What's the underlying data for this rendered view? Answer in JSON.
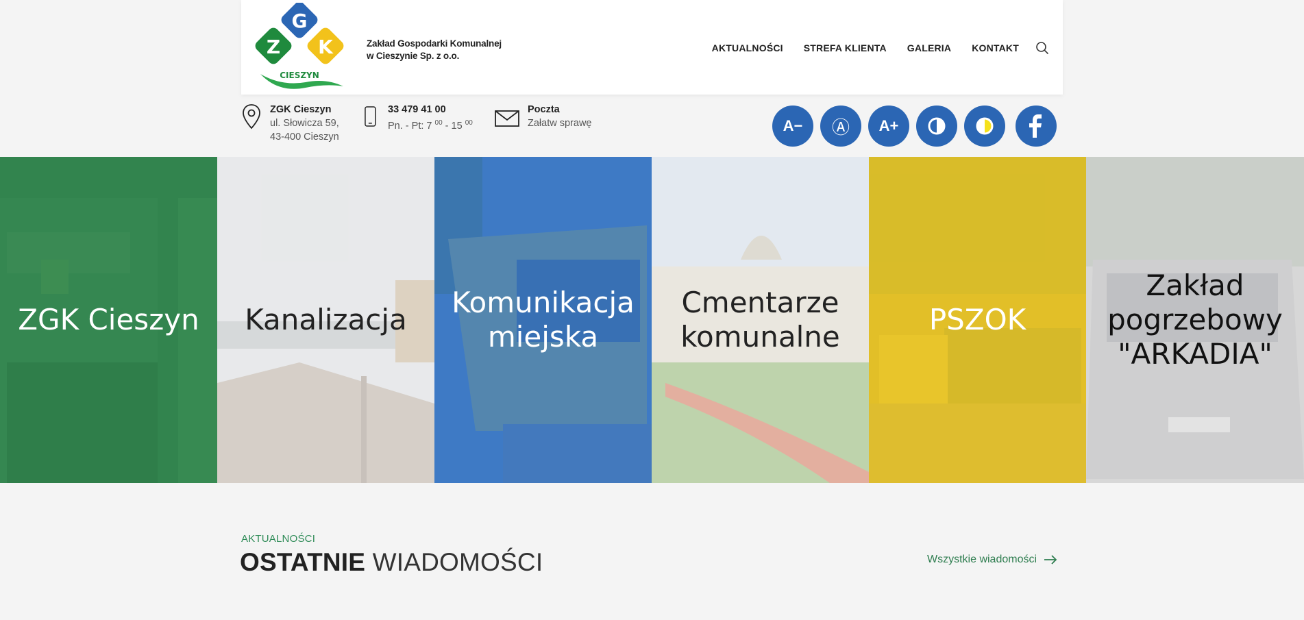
{
  "header": {
    "company_line1": "Zakład Gospodarki Komunalnej",
    "company_line2": "w Cieszynie Sp. z o.o.",
    "logo": {
      "letters": [
        "G",
        "Z",
        "K"
      ],
      "word": "CIESZYN"
    },
    "nav": [
      "AKTUALNOŚCI",
      "STREFA KLIENTA",
      "GALERIA",
      "KONTAKT"
    ],
    "search_icon": "search-icon"
  },
  "info": {
    "address": {
      "title": "ZGK Cieszyn",
      "line1": "ul. Słowicza 59,",
      "line2": "43-400 Cieszyn",
      "icon": "location-pin-icon"
    },
    "phone": {
      "title": "33 479 41 00",
      "hours_prefix": "Pn. - Pt: 7",
      "hours_open_sup": "00",
      "hours_mid": " - 15",
      "hours_close_sup": "00",
      "icon": "phone-icon"
    },
    "mail": {
      "title": "Poczta",
      "subtitle": "Załatw sprawę",
      "icon": "envelope-icon"
    }
  },
  "accessibility": {
    "buttons": [
      "A−",
      "Ⓐ",
      "A+"
    ],
    "icons": [
      "font-decrease-icon",
      "font-reset-icon",
      "font-increase-icon",
      "contrast-icon",
      "contrast-yellow-icon",
      "facebook-icon"
    ]
  },
  "tiles": [
    {
      "label": "ZGK Cieszyn",
      "color": "#2f8a4f"
    },
    {
      "label": "Kanalizacja",
      "color": "#e8e8e8"
    },
    {
      "label": "Komunikacja miejska",
      "color": "#3a78c4"
    },
    {
      "label": "Cmentarze komunalne",
      "color": "#eaeaea"
    },
    {
      "label": "PSZOK",
      "color": "#e3c22a"
    },
    {
      "label": "Zakład pogrzebowy \"ARKADIA\"",
      "color": "#d5d5d5"
    }
  ],
  "news": {
    "kicker": "AKTUALNOŚCI",
    "title_bold": "OSTATNIE",
    "title_light": "WIADOMOŚCI",
    "all_link": "Wszystkie wiadomości"
  },
  "colors": {
    "brand_blue": "#2b66b4",
    "brand_green": "#2e8b57",
    "brand_yellow": "#f2c21b"
  }
}
